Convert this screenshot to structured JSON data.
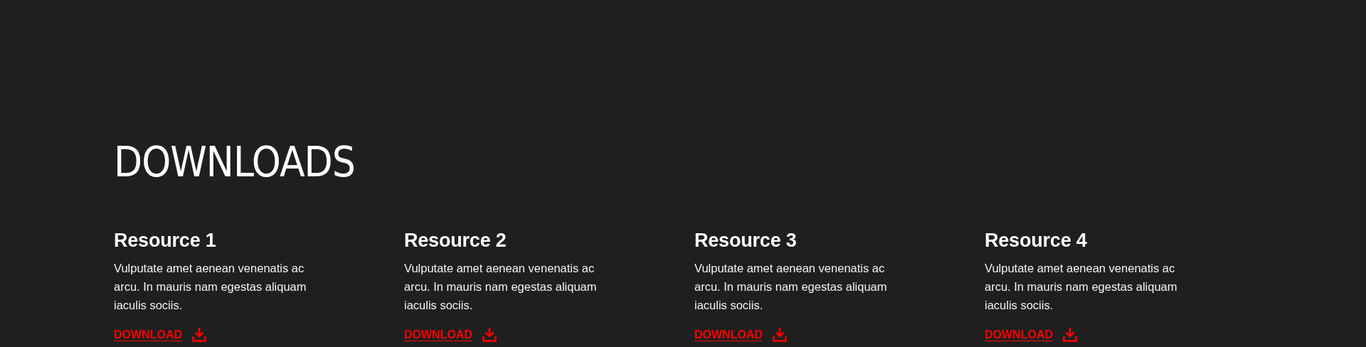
{
  "section": {
    "title": "DOWNLOADS"
  },
  "resources": [
    {
      "title": "Resource 1",
      "description": "Vulputate amet aenean venenatis ac arcu. In mauris nam egestas aliquam iaculis sociis.",
      "link": "DOWNLOAD"
    },
    {
      "title": "Resource 2",
      "description": "Vulputate amet aenean venenatis ac arcu. In mauris nam egestas aliquam iaculis sociis.",
      "link": "DOWNLOAD"
    },
    {
      "title": "Resource 3",
      "description": "Vulputate amet aenean venenatis ac arcu. In mauris nam egestas aliquam iaculis sociis.",
      "link": "DOWNLOAD"
    },
    {
      "title": "Resource 4",
      "description": "Vulputate amet aenean venenatis ac arcu. In mauris nam egestas aliquam iaculis sociis.",
      "link": "DOWNLOAD"
    }
  ]
}
